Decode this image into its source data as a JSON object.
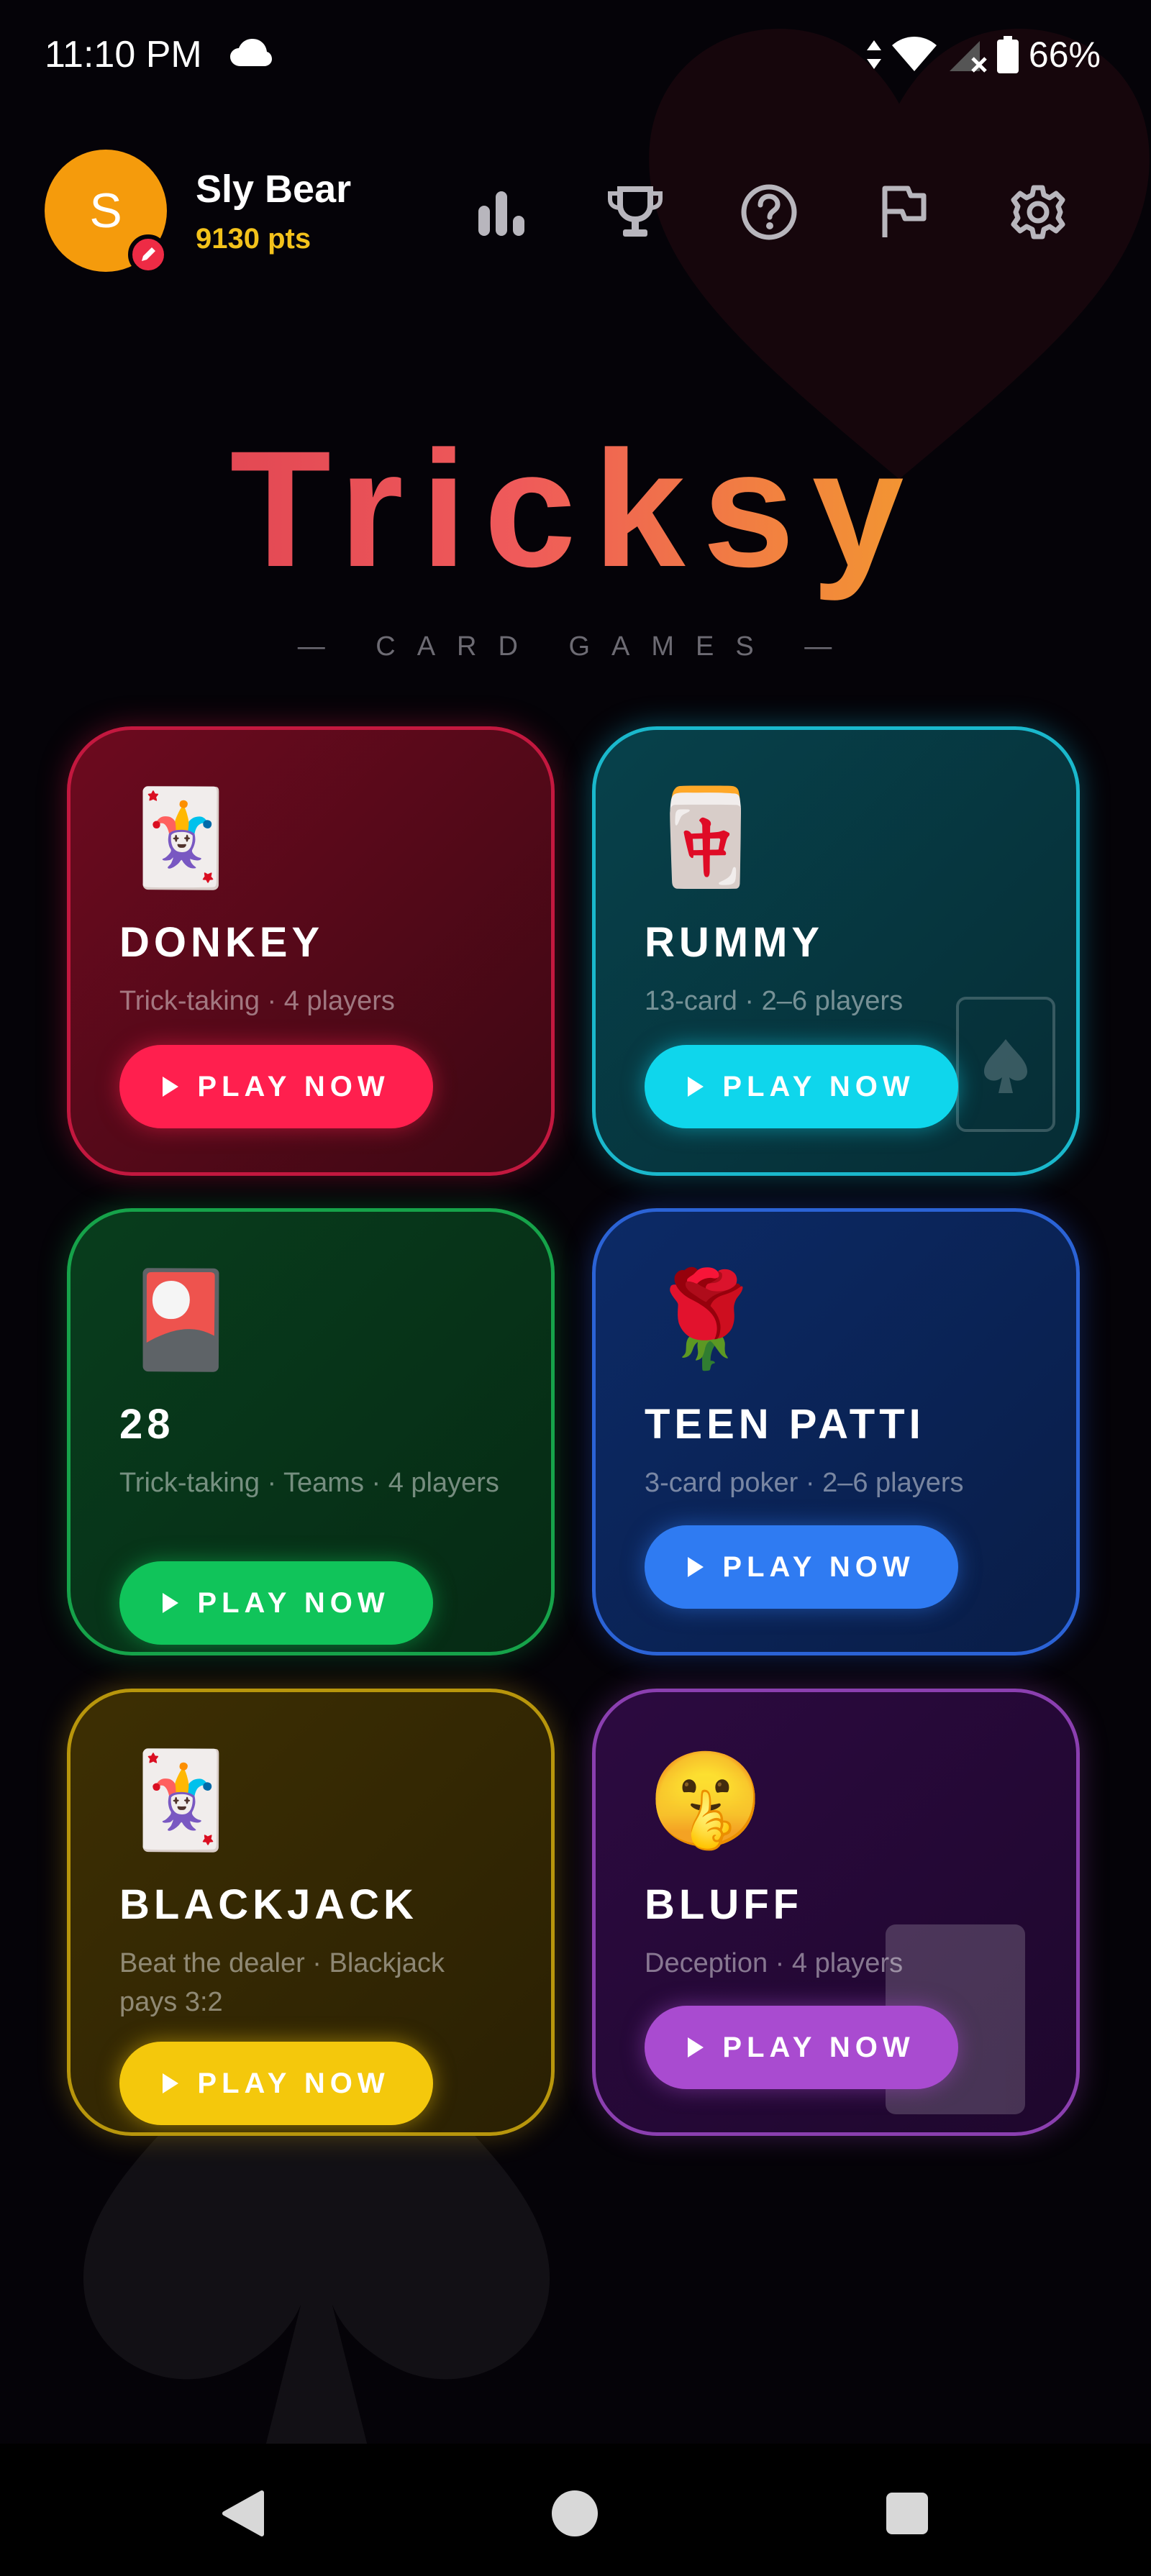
{
  "status_bar": {
    "time": "11:10 PM",
    "battery": "66%"
  },
  "profile": {
    "avatar_letter": "S",
    "username": "Sly Bear",
    "points": "9130 pts"
  },
  "header_icons": [
    "bar-chart-icon",
    "trophy-icon",
    "help-icon",
    "flag-icon",
    "gear-icon"
  ],
  "logo": {
    "title": "Tricksy",
    "tagline": "— CARD GAMES —"
  },
  "games": [
    {
      "name": "DONKEY",
      "subtitle": "Trick-taking · 4 players",
      "icon": "joker-card-icon",
      "emoji": "🃏",
      "button": "PLAY NOW",
      "accent": "#ff1f4e"
    },
    {
      "name": "RUMMY",
      "subtitle": "13-card · 2–6 players",
      "icon": "mahjong-tile-icon",
      "emoji": "🀄",
      "button": "PLAY NOW",
      "accent": "#0fd6ec"
    },
    {
      "name": "28",
      "subtitle": "Trick-taking · Teams · 4 players",
      "icon": "flower-card-icon",
      "emoji": "🎴",
      "button": "PLAY NOW",
      "accent": "#10c45a"
    },
    {
      "name": "TEEN PATTI",
      "subtitle": "3-card poker · 2–6 players",
      "icon": "rose-icon",
      "emoji": "🌹",
      "button": "PLAY NOW",
      "accent": "#2f7bf2"
    },
    {
      "name": "BLACKJACK",
      "subtitle": "Beat the dealer · Blackjack pays 3:2",
      "icon": "joker-card-icon",
      "emoji": "🃏",
      "button": "PLAY NOW",
      "accent": "#f4c80c"
    },
    {
      "name": "BLUFF",
      "subtitle": "Deception · 4 players",
      "icon": "shushing-face-icon",
      "emoji": "🤫",
      "button": "PLAY NOW",
      "accent": "#a94bd0"
    }
  ]
}
